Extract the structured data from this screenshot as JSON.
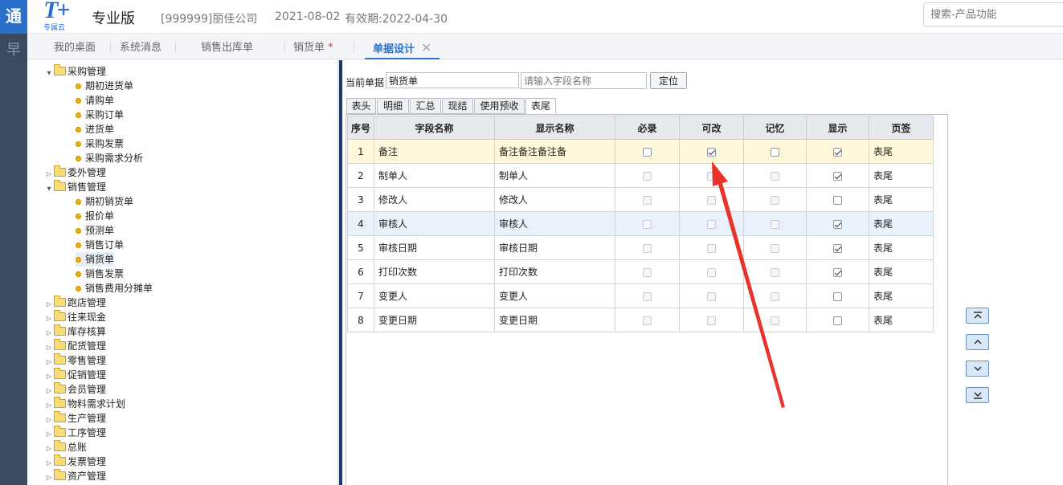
{
  "rail": {
    "logo_char": "通",
    "glyph": "早"
  },
  "header": {
    "logo_mark": "T+",
    "logo_sub": "专属云",
    "edition": "专业版",
    "company": "[999999]丽佳公司",
    "date": "2021-08-02",
    "validity": "有效期:2022-04-30",
    "search_placeholder": "搜索-产品功能"
  },
  "tabs": [
    {
      "label": "我的桌面"
    },
    {
      "label": "系统消息"
    },
    {
      "label": "销售出库单"
    },
    {
      "label": "销货单",
      "badge": "*"
    },
    {
      "label": "单据设计",
      "close": "✕"
    }
  ],
  "tree": [
    {
      "label": "采购管理",
      "type": "folder",
      "expanded": true
    },
    {
      "label": "期初进货单",
      "type": "leaf"
    },
    {
      "label": "请购单",
      "type": "leaf"
    },
    {
      "label": "采购订单",
      "type": "leaf"
    },
    {
      "label": "进货单",
      "type": "leaf"
    },
    {
      "label": "采购发票",
      "type": "leaf"
    },
    {
      "label": "采购需求分析",
      "type": "leaf"
    },
    {
      "label": "委外管理",
      "type": "folder",
      "expanded": false
    },
    {
      "label": "销售管理",
      "type": "folder",
      "expanded": true
    },
    {
      "label": "期初销货单",
      "type": "leaf"
    },
    {
      "label": "报价单",
      "type": "leaf"
    },
    {
      "label": "预测单",
      "type": "leaf"
    },
    {
      "label": "销售订单",
      "type": "leaf"
    },
    {
      "label": "销货单",
      "type": "leaf",
      "selected": true
    },
    {
      "label": "销售发票",
      "type": "leaf"
    },
    {
      "label": "销售费用分摊单",
      "type": "leaf"
    },
    {
      "label": "跑店管理",
      "type": "folder",
      "expanded": false
    },
    {
      "label": "往来现金",
      "type": "folder",
      "expanded": false
    },
    {
      "label": "库存核算",
      "type": "folder",
      "expanded": false
    },
    {
      "label": "配货管理",
      "type": "folder",
      "expanded": false
    },
    {
      "label": "零售管理",
      "type": "folder",
      "expanded": false
    },
    {
      "label": "促销管理",
      "type": "folder",
      "expanded": false
    },
    {
      "label": "会员管理",
      "type": "folder",
      "expanded": false
    },
    {
      "label": "物料需求计划",
      "type": "folder",
      "expanded": false
    },
    {
      "label": "生产管理",
      "type": "folder",
      "expanded": false
    },
    {
      "label": "工序管理",
      "type": "folder",
      "expanded": false
    },
    {
      "label": "总账",
      "type": "folder",
      "expanded": false
    },
    {
      "label": "发票管理",
      "type": "folder",
      "expanded": false
    },
    {
      "label": "资产管理",
      "type": "folder",
      "expanded": false
    }
  ],
  "design": {
    "doc_label": "当前单据",
    "doc_value": "销货单",
    "field_placeholder": "请输入字段名称",
    "locate_label": "定位",
    "subtabs": [
      "表头",
      "明细",
      "汇总",
      "现结",
      "使用预收",
      "表尾"
    ],
    "active_subtab": 5,
    "columns": [
      "序号",
      "字段名称",
      "显示名称",
      "必录",
      "可改",
      "记忆",
      "显示",
      "页签"
    ],
    "rows": [
      {
        "idx": "1",
        "field": "备注",
        "display": "备注备注备注备",
        "required": false,
        "editable": true,
        "memory": false,
        "show": true,
        "tab": "表尾",
        "disabled": false,
        "highlight": "yellow"
      },
      {
        "idx": "2",
        "field": "制单人",
        "display": "制单人",
        "required": false,
        "editable": false,
        "memory": false,
        "show": true,
        "tab": "表尾",
        "disabled": true,
        "highlight": ""
      },
      {
        "idx": "3",
        "field": "修改人",
        "display": "修改人",
        "required": false,
        "editable": false,
        "memory": false,
        "show": false,
        "tab": "表尾",
        "disabled": true,
        "highlight": ""
      },
      {
        "idx": "4",
        "field": "审核人",
        "display": "审核人",
        "required": false,
        "editable": false,
        "memory": false,
        "show": true,
        "tab": "表尾",
        "disabled": true,
        "highlight": "blue"
      },
      {
        "idx": "5",
        "field": "审核日期",
        "display": "审核日期",
        "required": false,
        "editable": false,
        "memory": false,
        "show": true,
        "tab": "表尾",
        "disabled": true,
        "highlight": ""
      },
      {
        "idx": "6",
        "field": "打印次数",
        "display": "打印次数",
        "required": false,
        "editable": false,
        "memory": false,
        "show": true,
        "tab": "表尾",
        "disabled": true,
        "highlight": ""
      },
      {
        "idx": "7",
        "field": "变更人",
        "display": "变更人",
        "required": false,
        "editable": false,
        "memory": false,
        "show": false,
        "tab": "表尾",
        "disabled": true,
        "highlight": ""
      },
      {
        "idx": "8",
        "field": "变更日期",
        "display": "变更日期",
        "required": false,
        "editable": false,
        "memory": false,
        "show": false,
        "tab": "表尾",
        "disabled": true,
        "highlight": ""
      }
    ]
  },
  "move_buttons": [
    {
      "name": "move-top-button",
      "icon": "arrow-top-icon"
    },
    {
      "name": "move-up-button",
      "icon": "arrow-up-icon"
    },
    {
      "name": "move-down-button",
      "icon": "arrow-down-icon"
    },
    {
      "name": "move-bottom-button",
      "icon": "arrow-bottom-icon"
    }
  ],
  "colors": {
    "brand": "#2a6fc9",
    "annotation_arrow": "#e8332a",
    "rail": "#3b4a5e"
  }
}
